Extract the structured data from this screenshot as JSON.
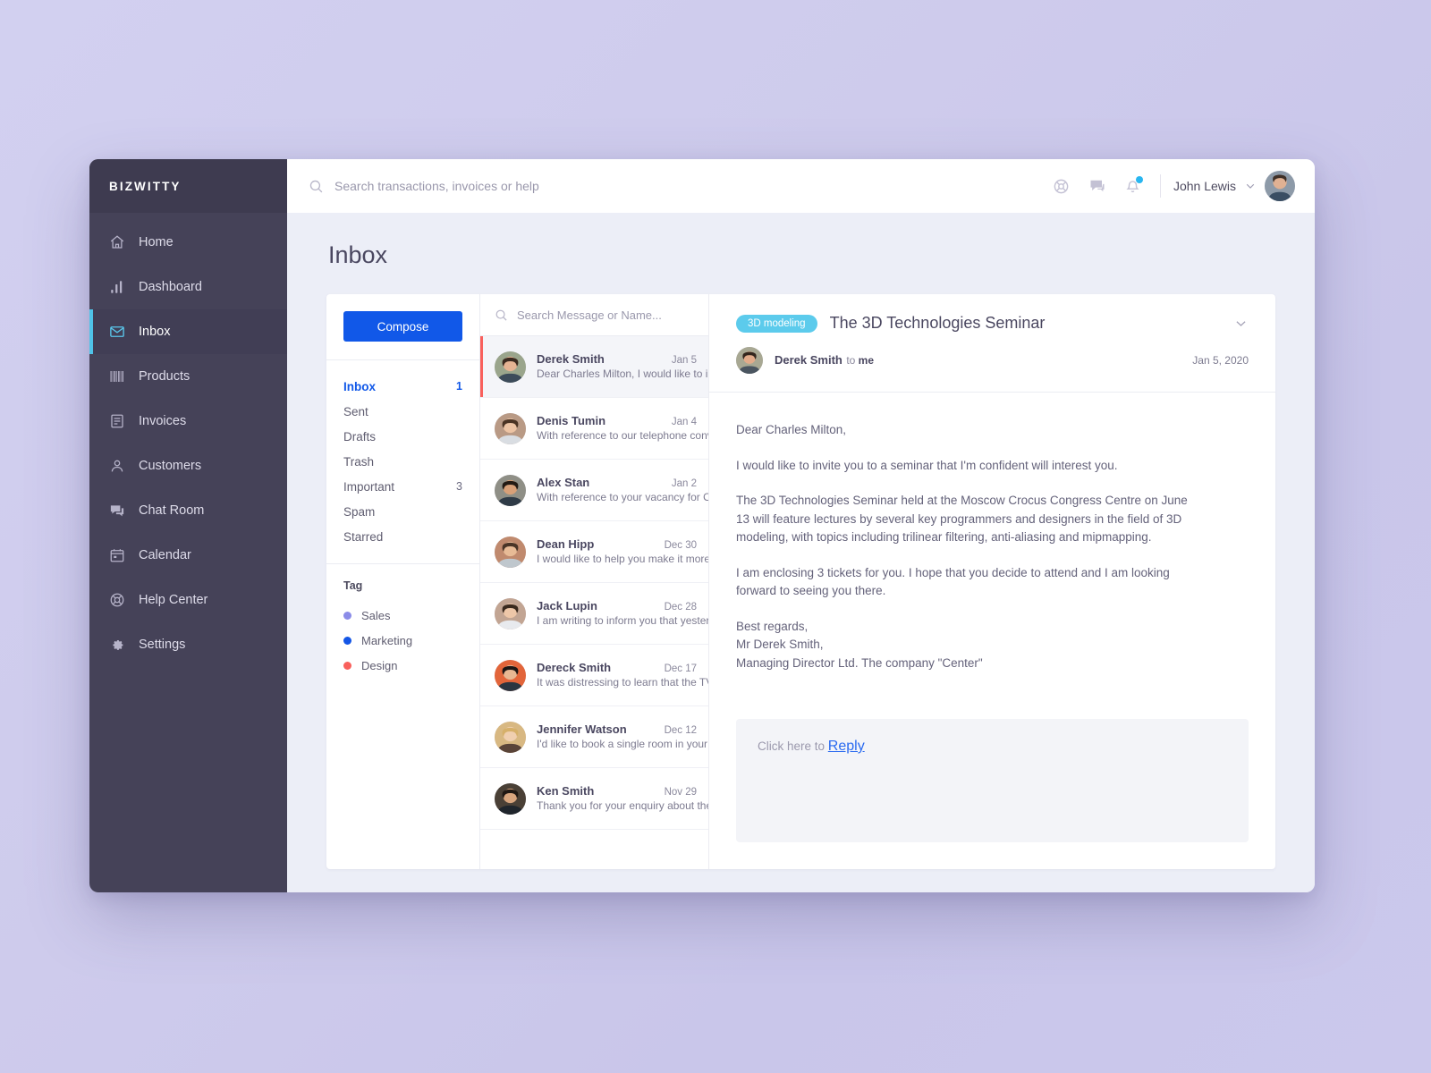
{
  "brand": {
    "name": "BIZWITTY"
  },
  "sidebar": {
    "items": [
      {
        "label": "Home",
        "icon": "home-icon",
        "active": false
      },
      {
        "label": "Dashboard",
        "icon": "chart-bar-icon",
        "active": false
      },
      {
        "label": "Inbox",
        "icon": "envelope-icon",
        "active": true
      },
      {
        "label": "Products",
        "icon": "barcode-icon",
        "active": false
      },
      {
        "label": "Invoices",
        "icon": "invoice-icon",
        "active": false
      },
      {
        "label": "Customers",
        "icon": "user-icon",
        "active": false
      },
      {
        "label": "Chat Room",
        "icon": "chat-icon",
        "active": false
      },
      {
        "label": "Calendar",
        "icon": "calendar-icon",
        "active": false
      },
      {
        "label": "Help Center",
        "icon": "lifebuoy-icon",
        "active": false
      },
      {
        "label": "Settings",
        "icon": "gear-icon",
        "active": false
      }
    ]
  },
  "topbar": {
    "search_placeholder": "Search transactions, invoices or help",
    "search_value": "",
    "icons": [
      "lifebuoy-icon",
      "chat-bubble-icon",
      "bell-icon"
    ],
    "notification_badge_color": "#29b6f0",
    "user_name": "John Lewis"
  },
  "page": {
    "title": "Inbox"
  },
  "folders_panel": {
    "compose_label": "Compose",
    "folders": [
      {
        "name": "Inbox",
        "count": "1",
        "active": true
      },
      {
        "name": "Sent",
        "count": "",
        "active": false
      },
      {
        "name": "Drafts",
        "count": "",
        "active": false
      },
      {
        "name": "Trash",
        "count": "",
        "active": false
      },
      {
        "name": "Important",
        "count": "3",
        "active": false
      },
      {
        "name": "Spam",
        "count": "",
        "active": false
      },
      {
        "name": "Starred",
        "count": "",
        "active": false
      }
    ],
    "tag_title": "Tag",
    "tags": [
      {
        "label": "Sales",
        "color": "#8b8ce8"
      },
      {
        "label": "Marketing",
        "color": "#1456e6"
      },
      {
        "label": "Design",
        "color": "#f9605c"
      }
    ]
  },
  "message_list": {
    "search_placeholder": "Search Message or Name...",
    "search_value": "",
    "messages": [
      {
        "name": "Derek Smith",
        "date": "Jan 5",
        "preview": "Dear Charles Milton, I would like to invit…",
        "selected": true,
        "avatar_tone": "#9aa58c"
      },
      {
        "name": "Denis Tumin",
        "date": "Jan 4",
        "preview": "With reference to our telephone conver…",
        "selected": false,
        "avatar_tone": "#b99a85"
      },
      {
        "name": "Alex Stan",
        "date": "Jan 2",
        "preview": "With reference to your vacancy for Offi…",
        "selected": false,
        "avatar_tone": "#8f8f86"
      },
      {
        "name": "Dean Hipp",
        "date": "Dec 30",
        "preview": "I would like to help you make it more att…",
        "selected": false,
        "avatar_tone": "#c08a6e"
      },
      {
        "name": "Jack Lupin",
        "date": "Dec 28",
        "preview": "I am writing to inform you that yesterda…",
        "selected": false,
        "avatar_tone": "#c2a593"
      },
      {
        "name": "Dereck Smith",
        "date": "Dec 17",
        "preview": "It was distressing to learn that the TV se…",
        "selected": false,
        "avatar_tone": "#e2653a"
      },
      {
        "name": "Jennifer Watson",
        "date": "Dec 12",
        "preview": "I'd like to book a single room in your hot…",
        "selected": false,
        "avatar_tone": "#d8b882"
      },
      {
        "name": "Ken Smith",
        "date": "Nov 29",
        "preview": "Thank you for your enquiry about the st…",
        "selected": false,
        "avatar_tone": "#4a4036"
      }
    ]
  },
  "reading_pane": {
    "tag_label": "3D modeling",
    "tag_color": "#5ccbec",
    "subject": "The 3D Technologies Seminar",
    "sender_name": "Derek Smith",
    "to_prefix": "to ",
    "to_target": "me",
    "date": "Jan 5, 2020",
    "paragraphs": [
      "Dear Charles Milton,",
      "I would like to invite you to a seminar that I'm confident will interest you.",
      "The 3D Technologies Seminar held at the Moscow Crocus Congress Centre on June 13 will feature lectures by several key programmers and designers in the field of 3D modeling, with topics including trilinear filtering, anti-aliasing and mipmapping.",
      "I am enclosing 3 tickets for you. I hope that you decide to attend and I am looking forward to seeing you there."
    ],
    "signature": [
      "Best regards,",
      "Mr Derek Smith,",
      "Managing Director Ltd. The company \"Center\""
    ],
    "reply_prompt": "Click here to ",
    "reply_link": "Reply"
  }
}
